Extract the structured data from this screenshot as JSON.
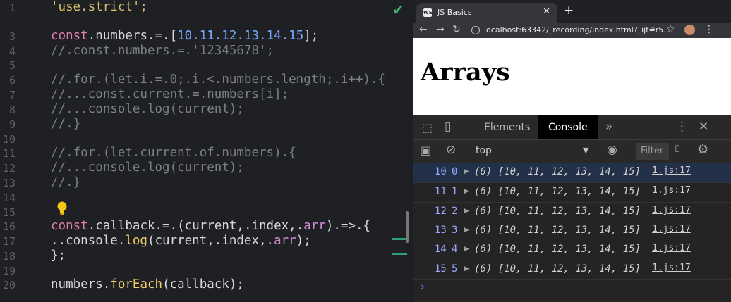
{
  "editor": {
    "line_numbers": [
      "1",
      "3",
      "4",
      "5",
      "6",
      "7",
      "8",
      "9",
      "10",
      "11",
      "12",
      "13",
      "14",
      "15",
      "16",
      "17",
      "18",
      "19",
      "20"
    ],
    "lines": {
      "l1": "'use.strict';",
      "l3_kw": "const",
      "l3_a": ".numbers.=.[",
      "l3_nums": [
        "10",
        ".11",
        ".12",
        ".13",
        ".14",
        ".15"
      ],
      "l3_end": "];",
      "l4": "//.const.numbers.=.'12345678';",
      "l6": "//.for.(let.i.=.0;.i.<.numbers.length;.i++).{",
      "l7": "//...const.current.=.numbers[i];",
      "l8": "//...console.log(current);",
      "l9": "//.}",
      "l11": "//.for.(let.current.of.numbers).{",
      "l12": "//...console.log(current);",
      "l13": "//.}",
      "l16_kw": "const",
      "l16_a": ".callback",
      "l16_b": ".=.(current,.index,.",
      "l16_arr": "arr",
      "l16_c": ").=>.{",
      "l17_a": "..console.",
      "l17_fn": "log",
      "l17_b": "(current,.index,.",
      "l17_arr": "arr",
      "l17_c": ");",
      "l18": "};",
      "l20_a": "numbers.",
      "l20_fn": "forEach",
      "l20_b": "(callback);"
    },
    "colors": {
      "keyword": "#e07fb0",
      "number": "#78a8ff",
      "string": "#d6c16a",
      "comment": "#7c7f86"
    }
  },
  "browser": {
    "tab_title": "JS Basics",
    "favicon_text": "WS",
    "url": "localhost:63342/_recording/index.html?_ijt=r5...",
    "page_heading": "Arrays"
  },
  "devtools": {
    "tabs": [
      "Elements",
      "Console"
    ],
    "active_tab": "Console",
    "more_tabs": "»",
    "context": "top",
    "filter_placeholder": "Filter",
    "logs": [
      {
        "current": "10",
        "index": "0",
        "array": "(6) [10, 11, 12, 13, 14, 15]",
        "source": "1.js:17"
      },
      {
        "current": "11",
        "index": "1",
        "array": "(6) [10, 11, 12, 13, 14, 15]",
        "source": "1.js:17"
      },
      {
        "current": "12",
        "index": "2",
        "array": "(6) [10, 11, 12, 13, 14, 15]",
        "source": "1.js:17"
      },
      {
        "current": "13",
        "index": "3",
        "array": "(6) [10, 11, 12, 13, 14, 15]",
        "source": "1.js:17"
      },
      {
        "current": "14",
        "index": "4",
        "array": "(6) [10, 11, 12, 13, 14, 15]",
        "source": "1.js:17"
      },
      {
        "current": "15",
        "index": "5",
        "array": "(6) [10, 11, 12, 13, 14, 15]",
        "source": "1.js:17"
      }
    ],
    "prompt_symbol": "›"
  }
}
